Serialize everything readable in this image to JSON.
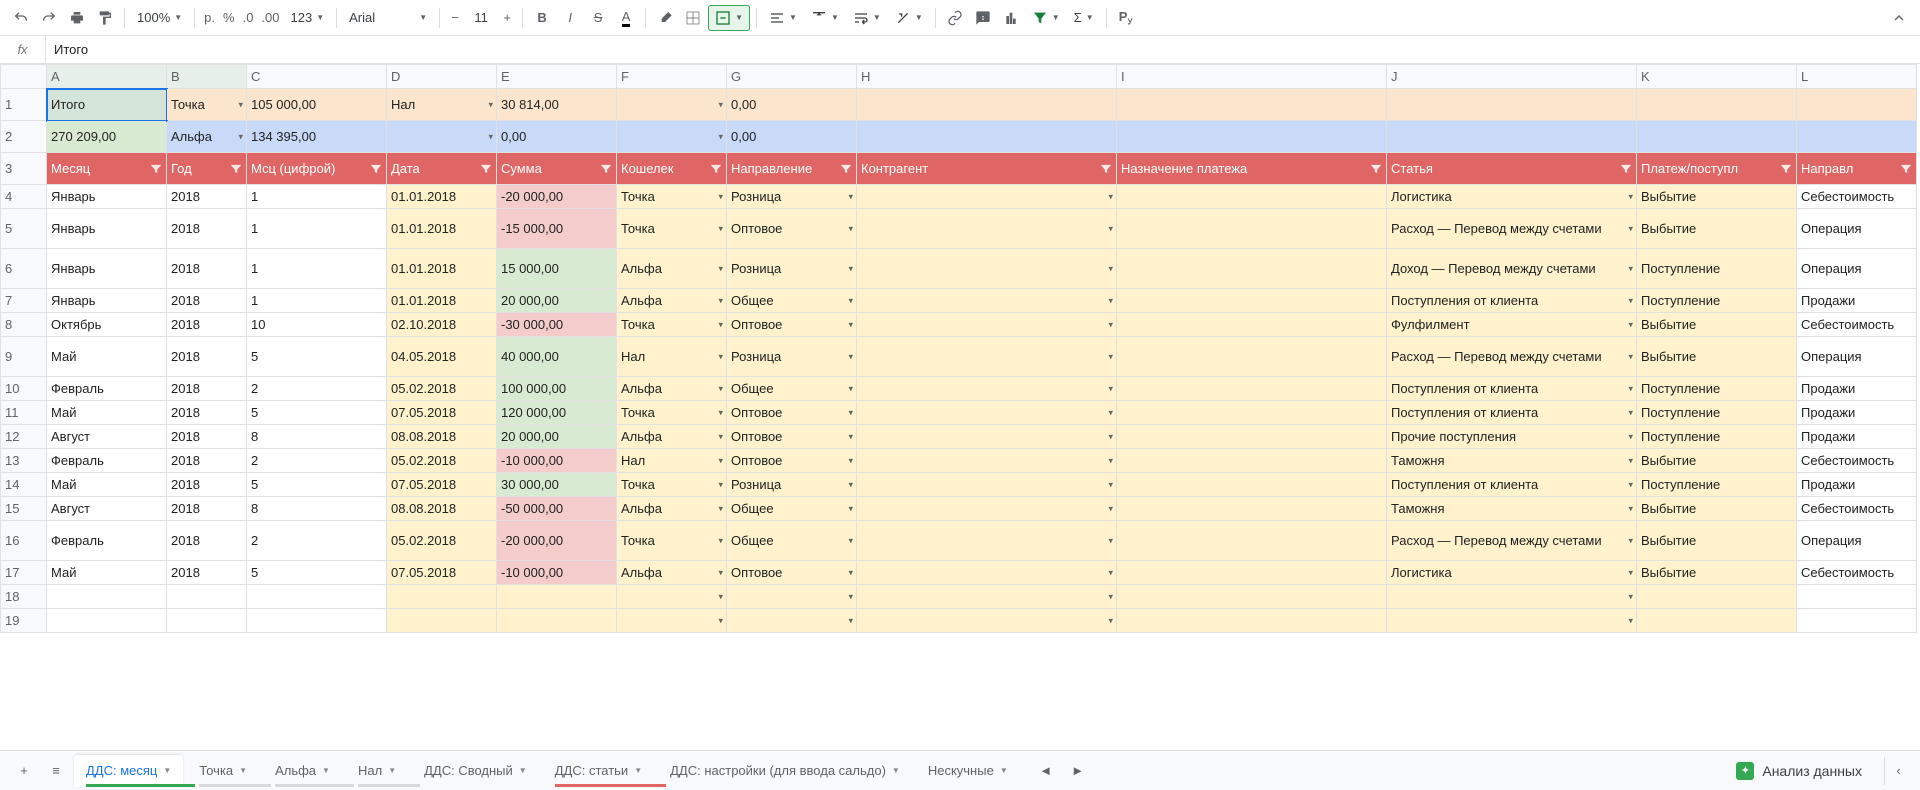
{
  "toolbar": {
    "zoom": "100%",
    "currency": "р.",
    "percent": "%",
    "dec_minus": ".0",
    "dec_plus": ".00",
    "format": "123",
    "font": "Arial",
    "size": "11"
  },
  "fx": {
    "label": "fx",
    "value": "Итого"
  },
  "columns": [
    "A",
    "B",
    "C",
    "D",
    "E",
    "F",
    "G",
    "H",
    "I",
    "J",
    "K",
    "L"
  ],
  "summary": [
    {
      "row": "1",
      "cells": [
        "Итого",
        "Точка",
        "105 000,00",
        "Нал",
        "30 814,00",
        "",
        "0,00",
        "",
        "",
        "",
        "",
        ""
      ]
    },
    {
      "row": "2",
      "cells": [
        "270 209,00",
        "Альфа",
        "134 395,00",
        "",
        "0,00",
        "",
        "0,00",
        "",
        "",
        "",
        "",
        ""
      ]
    }
  ],
  "headers": [
    "Месяц",
    "Год",
    "Мсц (цифрой)",
    "Дата",
    "Сумма",
    "Кошелек",
    "Направление",
    "Контрагент",
    "Назначение платежа",
    "Статья",
    "Платеж/поступл",
    "Направл"
  ],
  "rows": [
    {
      "n": "4",
      "h": 0,
      "c": [
        "Январь",
        "2018",
        "1",
        "01.01.2018",
        "-20 000,00",
        "Точка",
        "Розница",
        "",
        "",
        "Логистика",
        "Выбытие",
        "Себестоимость"
      ],
      "amt": "neg"
    },
    {
      "n": "5",
      "h": 1,
      "c": [
        "Январь",
        "2018",
        "1",
        "01.01.2018",
        "-15 000,00",
        "Точка",
        "Оптовое",
        "",
        "",
        "Расход — Перевод между счетами",
        "Выбытие",
        "Операция"
      ],
      "amt": "neg"
    },
    {
      "n": "6",
      "h": 1,
      "c": [
        "Январь",
        "2018",
        "1",
        "01.01.2018",
        "15 000,00",
        "Альфа",
        "Розница",
        "",
        "",
        "Доход — Перевод между счетами",
        "Поступление",
        "Операция"
      ],
      "amt": "pos"
    },
    {
      "n": "7",
      "h": 0,
      "c": [
        "Январь",
        "2018",
        "1",
        "01.01.2018",
        "20 000,00",
        "Альфа",
        "Общее",
        "",
        "",
        "Поступления от клиента",
        "Поступление",
        "Продажи"
      ],
      "amt": "pos"
    },
    {
      "n": "8",
      "h": 0,
      "c": [
        "Октябрь",
        "2018",
        "10",
        "02.10.2018",
        "-30 000,00",
        "Точка",
        "Оптовое",
        "",
        "",
        "Фулфилмент",
        "Выбытие",
        "Себестоимость"
      ],
      "amt": "neg"
    },
    {
      "n": "9",
      "h": 1,
      "c": [
        "Май",
        "2018",
        "5",
        "04.05.2018",
        "40 000,00",
        "Нал",
        "Розница",
        "",
        "",
        "Расход — Перевод между счетами",
        "Выбытие",
        "Операция"
      ],
      "amt": "pos"
    },
    {
      "n": "10",
      "h": 0,
      "c": [
        "Февраль",
        "2018",
        "2",
        "05.02.2018",
        "100 000,00",
        "Альфа",
        "Общее",
        "",
        "",
        "Поступления от клиента",
        "Поступление",
        "Продажи"
      ],
      "amt": "pos"
    },
    {
      "n": "11",
      "h": 0,
      "c": [
        "Май",
        "2018",
        "5",
        "07.05.2018",
        "120 000,00",
        "Точка",
        "Оптовое",
        "",
        "",
        "Поступления от клиента",
        "Поступление",
        "Продажи"
      ],
      "amt": "pos"
    },
    {
      "n": "12",
      "h": 0,
      "c": [
        "Август",
        "2018",
        "8",
        "08.08.2018",
        "20 000,00",
        "Альфа",
        "Оптовое",
        "",
        "",
        "Прочие поступления",
        "Поступление",
        "Продажи"
      ],
      "amt": "pos"
    },
    {
      "n": "13",
      "h": 0,
      "c": [
        "Февраль",
        "2018",
        "2",
        "05.02.2018",
        "-10 000,00",
        "Нал",
        "Оптовое",
        "",
        "",
        "Таможня",
        "Выбытие",
        "Себестоимость"
      ],
      "amt": "neg"
    },
    {
      "n": "14",
      "h": 0,
      "c": [
        "Май",
        "2018",
        "5",
        "07.05.2018",
        "30 000,00",
        "Точка",
        "Розница",
        "",
        "",
        "Поступления от клиента",
        "Поступление",
        "Продажи"
      ],
      "amt": "pos"
    },
    {
      "n": "15",
      "h": 0,
      "c": [
        "Август",
        "2018",
        "8",
        "08.08.2018",
        "-50 000,00",
        "Альфа",
        "Общее",
        "",
        "",
        "Таможня",
        "Выбытие",
        "Себестоимость"
      ],
      "amt": "neg"
    },
    {
      "n": "16",
      "h": 1,
      "c": [
        "Февраль",
        "2018",
        "2",
        "05.02.2018",
        "-20 000,00",
        "Точка",
        "Общее",
        "",
        "",
        "Расход — Перевод между счетами",
        "Выбытие",
        "Операция"
      ],
      "amt": "neg"
    },
    {
      "n": "17",
      "h": 0,
      "c": [
        "Май",
        "2018",
        "5",
        "07.05.2018",
        "-10 000,00",
        "Альфа",
        "Оптовое",
        "",
        "",
        "Логистика",
        "Выбытие",
        "Себестоимость"
      ],
      "amt": "neg"
    },
    {
      "n": "18",
      "h": 0,
      "c": [
        "",
        "",
        "",
        "",
        "",
        "",
        "",
        "",
        "",
        "",
        "",
        ""
      ],
      "amt": ""
    },
    {
      "n": "19",
      "h": 0,
      "c": [
        "",
        "",
        "",
        "",
        "",
        "",
        "",
        "",
        "",
        "",
        "",
        ""
      ],
      "amt": ""
    }
  ],
  "tabs": [
    {
      "label": "ДДС: месяц",
      "active": true,
      "color": "#34a853"
    },
    {
      "label": "Точка",
      "color": "#d9d9d9"
    },
    {
      "label": "Альфа",
      "color": "#d9d9d9"
    },
    {
      "label": "Нал",
      "color": "#d9d9d9"
    },
    {
      "label": "ДДС: Сводный",
      "color": ""
    },
    {
      "label": "ДДС: статьи",
      "color": "#e06666"
    },
    {
      "label": "ДДС: настройки (для ввода сальдо)",
      "color": ""
    },
    {
      "label": "Нескучные",
      "color": ""
    }
  ],
  "analyze": "Анализ данных"
}
